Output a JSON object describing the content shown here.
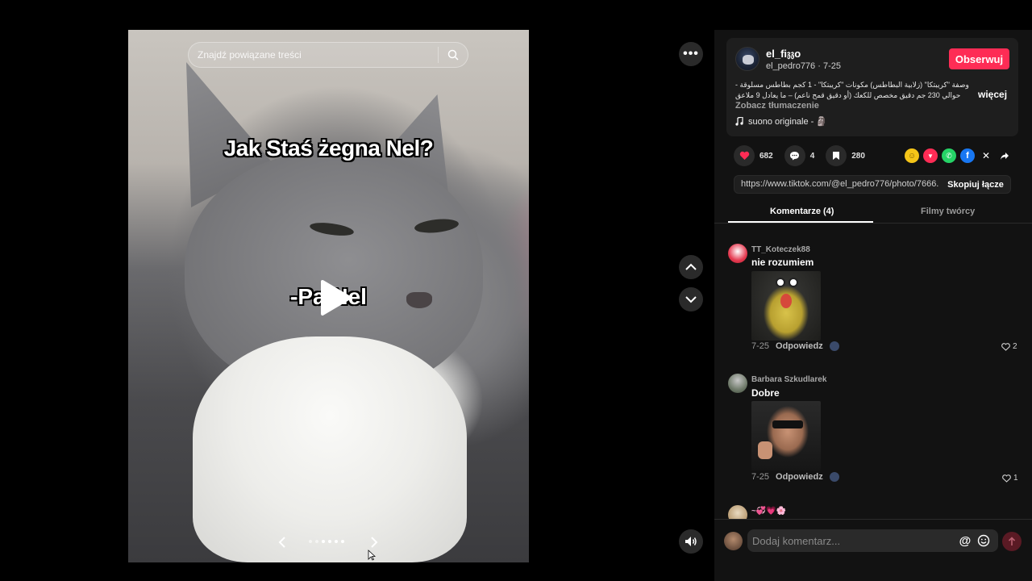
{
  "search": {
    "placeholder": "Znajdź powiązane treści"
  },
  "post": {
    "overlay_title": "Jak Staś żegna Nel?",
    "overlay_subtitle": "-Pa Nel",
    "slide_count": 6,
    "active_slide": 2
  },
  "author": {
    "display_name": "el_fi𝔷𝔷o",
    "handle": "el_pedro776",
    "date": "7-25",
    "follow_label": "Obserwuj"
  },
  "description": {
    "text": "وصفة \"كريبتكا\" (زلابية البطاطس) مكونات \"كريبتكا\" - 1 كجم بطاطس مسلوقة - حوالي 230 جم دقيق مخصص للكعك (أو دقيق قمح ناعم) – ما يعادل 9 ملاعق كبيرة مملحة –",
    "more_label": "więcej",
    "translate_label": "Zobacz tłumaczenie",
    "sound": "suono originale - 🗿"
  },
  "stats": {
    "likes": "682",
    "comments": "4",
    "saves": "280"
  },
  "share": {
    "url": "https://www.tiktok.com/@el_pedro776/photo/7666...",
    "copy_label": "Skopiuj łącze"
  },
  "tabs": {
    "comments_label": "Komentarze (4)",
    "creator_videos_label": "Filmy twórcy"
  },
  "comments": [
    {
      "author": "TT_Koteczek88",
      "text": "nie rozumiem",
      "date": "7-25",
      "reply_label": "Odpowiedz",
      "likes": "2"
    },
    {
      "author": "Barbara Szkudlarek",
      "text": "Dobre",
      "date": "7-25",
      "reply_label": "Odpowiedz",
      "likes": "1"
    },
    {
      "author": "~💞💗🌸",
      "text": "",
      "date": "",
      "reply_label": "",
      "likes": ""
    }
  ],
  "composer": {
    "placeholder": "Dodaj komentarz..."
  },
  "colors": {
    "accent": "#fe2c55",
    "panel": "#121212",
    "card": "#1e1e1e"
  },
  "icons": [
    "search-icon",
    "more-icon",
    "arrow-up-icon",
    "arrow-down-icon",
    "volume-icon",
    "play-icon",
    "heart-icon",
    "comment-icon",
    "bookmark-icon",
    "music-note-icon",
    "at-icon",
    "emoji-icon",
    "send-icon"
  ]
}
